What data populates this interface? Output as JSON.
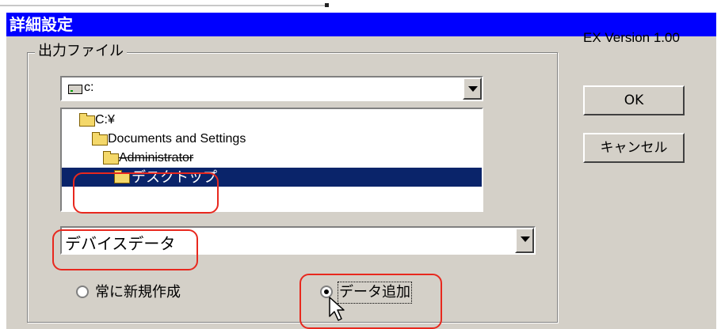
{
  "window": {
    "title": "詳細設定",
    "version": "EX Version 1.00"
  },
  "group": {
    "label": "出力ファイル"
  },
  "drive": {
    "value": "c:"
  },
  "directories": [
    {
      "label": "C:¥",
      "icon": "open-folder-icon",
      "selected": false
    },
    {
      "label": "Documents and Settings",
      "icon": "open-folder-icon",
      "selected": false
    },
    {
      "label": "Administrator",
      "icon": "open-folder-icon",
      "selected": false
    },
    {
      "label": "デスクトップ",
      "icon": "folder-icon",
      "selected": true
    }
  ],
  "file": {
    "value": "デバイスデータ"
  },
  "mode": {
    "options": [
      {
        "label": "常に新規作成",
        "checked": false
      },
      {
        "label": "データ追加",
        "checked": true
      }
    ]
  },
  "buttons": {
    "ok": "OK",
    "cancel": "キャンセル"
  },
  "colors": {
    "titlebar": "#0000ff",
    "dialog": "#d4d0c8",
    "selection": "#0a246a",
    "annotation": "#e8281e"
  }
}
